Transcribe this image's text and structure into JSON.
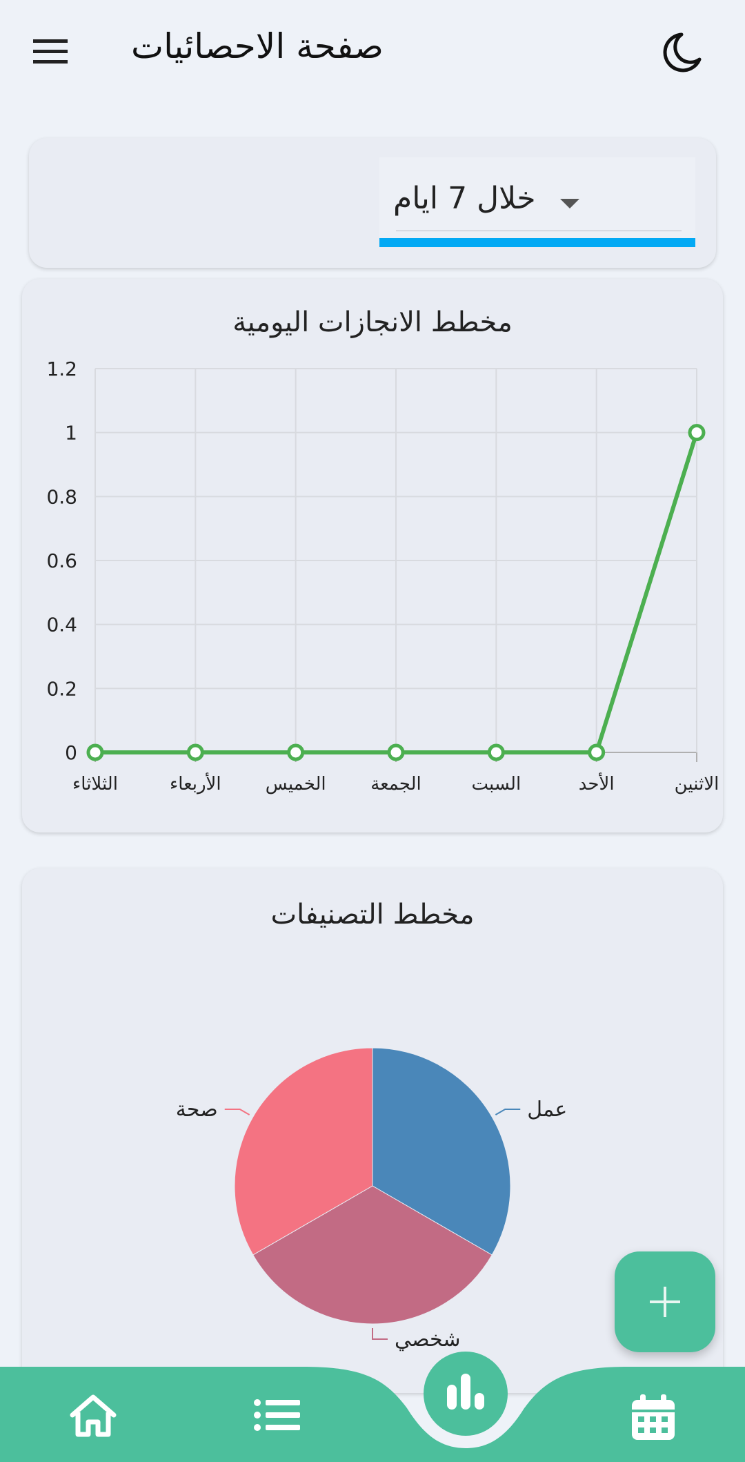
{
  "app": {
    "title": "صفحة الاحصائيات",
    "menu_icon": "menu-icon",
    "theme_icon": "moon-icon"
  },
  "filter": {
    "selected": "خلال 7 ايام",
    "accent_color": "#03a9f4"
  },
  "line_chart_title": "مخطط الانجازات اليومية",
  "pie_chart_title": "مخطط التصنيفات",
  "chart_data": [
    {
      "type": "line",
      "title": "مخطط الانجازات اليومية",
      "categories": [
        "الثلاثاء",
        "الأربعاء",
        "الخميس",
        "الجمعة",
        "السبت",
        "الأحد",
        "الاثنين"
      ],
      "series": [
        {
          "values": [
            0,
            0,
            0,
            0,
            0,
            0,
            1
          ],
          "color": "#4caf50"
        }
      ],
      "ylim": [
        0,
        1.2
      ],
      "yticks": [
        "0",
        "0.2",
        "0.4",
        "0.6",
        "0.8",
        "1",
        "1.2"
      ],
      "grid": true
    },
    {
      "type": "pie",
      "title": "مخطط التصنيفات",
      "labels": [
        "عمل",
        "شخصي",
        "صحة"
      ],
      "values": [
        1,
        1,
        1
      ],
      "colors": [
        "#4a87b9",
        "#c26b84",
        "#f47382"
      ]
    }
  ],
  "fab": {
    "icon": "plus-icon"
  },
  "navbar": {
    "color": "#4cbf9c",
    "items": [
      {
        "icon": "home-icon"
      },
      {
        "icon": "list-icon"
      },
      {
        "icon": "bar-chart-icon",
        "active": true
      },
      {
        "icon": "calendar-icon"
      }
    ]
  }
}
